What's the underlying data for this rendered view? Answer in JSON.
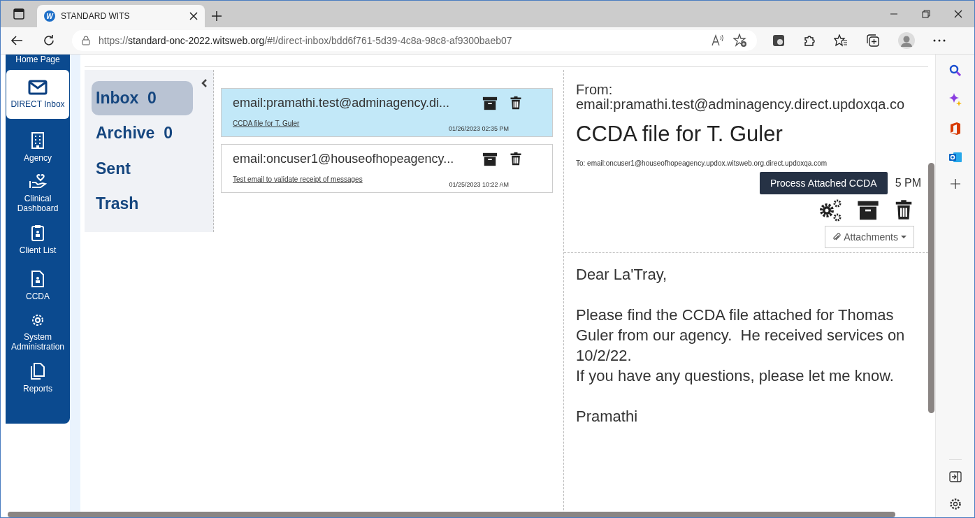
{
  "browser": {
    "tab": {
      "title": "STANDARD WITS",
      "favicon": "W"
    },
    "url": {
      "scheme": "https://",
      "host": "standard-onc-2022.witsweb.org",
      "path": "/#!/direct-inbox/bdd6f761-5d39-4c8a-98c8-af9300baeb07"
    }
  },
  "nav": {
    "items": [
      {
        "label": "Home Page",
        "selected": false
      },
      {
        "label": "DIRECT Inbox",
        "selected": true
      },
      {
        "label": "Agency",
        "selected": false
      },
      {
        "label": "Clinical Dashboard",
        "selected": false
      },
      {
        "label": "Client List",
        "selected": false
      },
      {
        "label": "CCDA",
        "selected": false
      },
      {
        "label": "System Administration",
        "selected": false
      },
      {
        "label": "Reports",
        "selected": false
      }
    ]
  },
  "folders": [
    {
      "label": "Inbox",
      "count": "0",
      "selected": true
    },
    {
      "label": "Archive",
      "count": "0",
      "selected": false
    },
    {
      "label": "Sent",
      "selected": false
    },
    {
      "label": "Trash",
      "selected": false
    }
  ],
  "messages": [
    {
      "from": "email:pramathi.test@adminagency.di...",
      "subject": "CCDA file for T. Guler",
      "date": "01/26/2023 02:35 PM",
      "selected": true
    },
    {
      "from": "email:oncuser1@houseofhopeagency...",
      "subject": "Test email to validate receipt of messages",
      "date": "01/25/2023 10:22 AM",
      "selected": false
    }
  ],
  "reader": {
    "from_label": "From:",
    "from": "email:pramathi.test@adminagency.direct.updoxqa.co",
    "subject": "CCDA file for T. Guler",
    "to": "To: email:oncuser1@houseofhopeagency.updox.witsweb.org.direct.updoxqa.com",
    "date": "5 PM",
    "tooltip": "Process Attached CCDA",
    "attachments": "Attachments",
    "body": [
      "Dear La'Tray,",
      "Please find the CCDA file attached for Thomas Guler from our agency.  He received services on 10/2/22.\nIf you have any questions, please let me know.",
      "Pramathi"
    ]
  }
}
